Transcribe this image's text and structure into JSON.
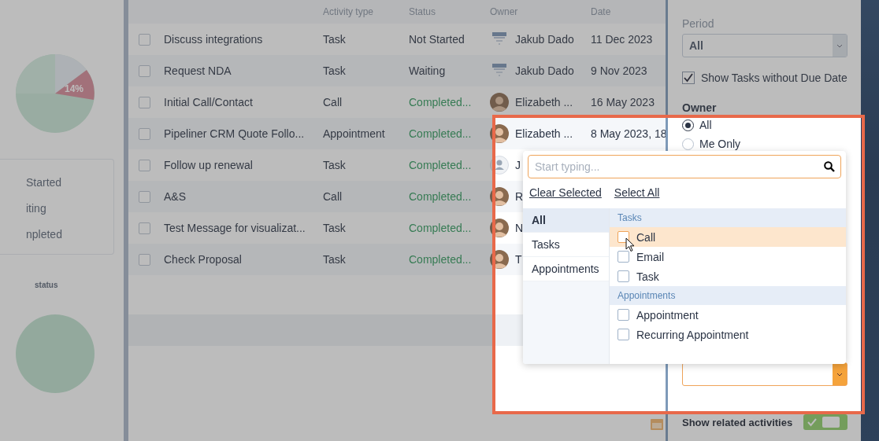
{
  "left_panel": {
    "pie_label": "14%",
    "legend": [
      "Started",
      "iting",
      "npleted"
    ],
    "section_label": "status"
  },
  "table": {
    "columns": [
      "Activity type",
      "Status",
      "Owner",
      "Date"
    ],
    "rows": [
      {
        "subject": "Discuss integrations",
        "type": "Task",
        "status": "Not Started",
        "done": false,
        "owner": "Jakub Dado",
        "kind": "calendar",
        "checked": false,
        "date": "11 Dec 2023"
      },
      {
        "subject": "Request NDA",
        "type": "Task",
        "status": "Waiting",
        "done": false,
        "owner": "Jakub Dado",
        "kind": "calendar",
        "checked": false,
        "date": "9 Nov 2023"
      },
      {
        "subject": "Initial Call/Contact",
        "type": "Call",
        "status": "Completed...",
        "done": true,
        "owner": "Elizabeth ...",
        "kind": "photo",
        "checked": false,
        "date": "16 May 2023"
      },
      {
        "subject": "Pipeliner CRM Quote Follo...",
        "type": "Appointment",
        "status": "Completed...",
        "done": true,
        "owner": "Elizabeth ...",
        "kind": "photo",
        "checked": false,
        "date": "8 May 2023, 18"
      },
      {
        "subject": "Follow up renewal",
        "type": "Task",
        "status": "Completed...",
        "done": true,
        "owner": "J",
        "kind": "person",
        "checked": false
      },
      {
        "subject": "A&S",
        "type": "Call",
        "status": "Completed...",
        "done": true,
        "owner": "R",
        "kind": "photo",
        "checked": false
      },
      {
        "subject": "Test Message for visualizat...",
        "type": "Task",
        "status": "Completed...",
        "done": true,
        "owner": "N",
        "kind": "photo",
        "checked": false
      },
      {
        "subject": "Check Proposal",
        "type": "Task",
        "status": "Completed...",
        "done": true,
        "owner": "T",
        "kind": "photo",
        "checked": false
      }
    ]
  },
  "filters": {
    "period_label": "Period",
    "period_value": "All",
    "no_due": {
      "label": "Show Tasks without Due Date",
      "checked": true
    },
    "owner_label": "Owner",
    "owner_options": [
      {
        "label": "All",
        "selected": true
      },
      {
        "label": "Me Only",
        "selected": false
      }
    ],
    "related": {
      "label": "Show related activities",
      "on": true
    }
  },
  "popup": {
    "placeholder": "Start typing...",
    "actions": [
      "Clear Selected",
      "Select All"
    ],
    "categories": [
      {
        "label": "All",
        "selected": true
      },
      {
        "label": "Tasks",
        "selected": false
      },
      {
        "label": "Appointments",
        "selected": false
      }
    ],
    "groups": [
      {
        "title": "Tasks",
        "items": [
          {
            "label": "Call",
            "checked": false,
            "hovered": true
          },
          {
            "label": "Email",
            "checked": false,
            "hovered": false
          },
          {
            "label": "Task",
            "checked": false,
            "hovered": false
          }
        ]
      },
      {
        "title": "Appointments",
        "items": [
          {
            "label": "Appointment",
            "checked": false,
            "hovered": false
          },
          {
            "label": "Recurring Appointment",
            "checked": false,
            "hovered": false
          }
        ]
      }
    ]
  }
}
